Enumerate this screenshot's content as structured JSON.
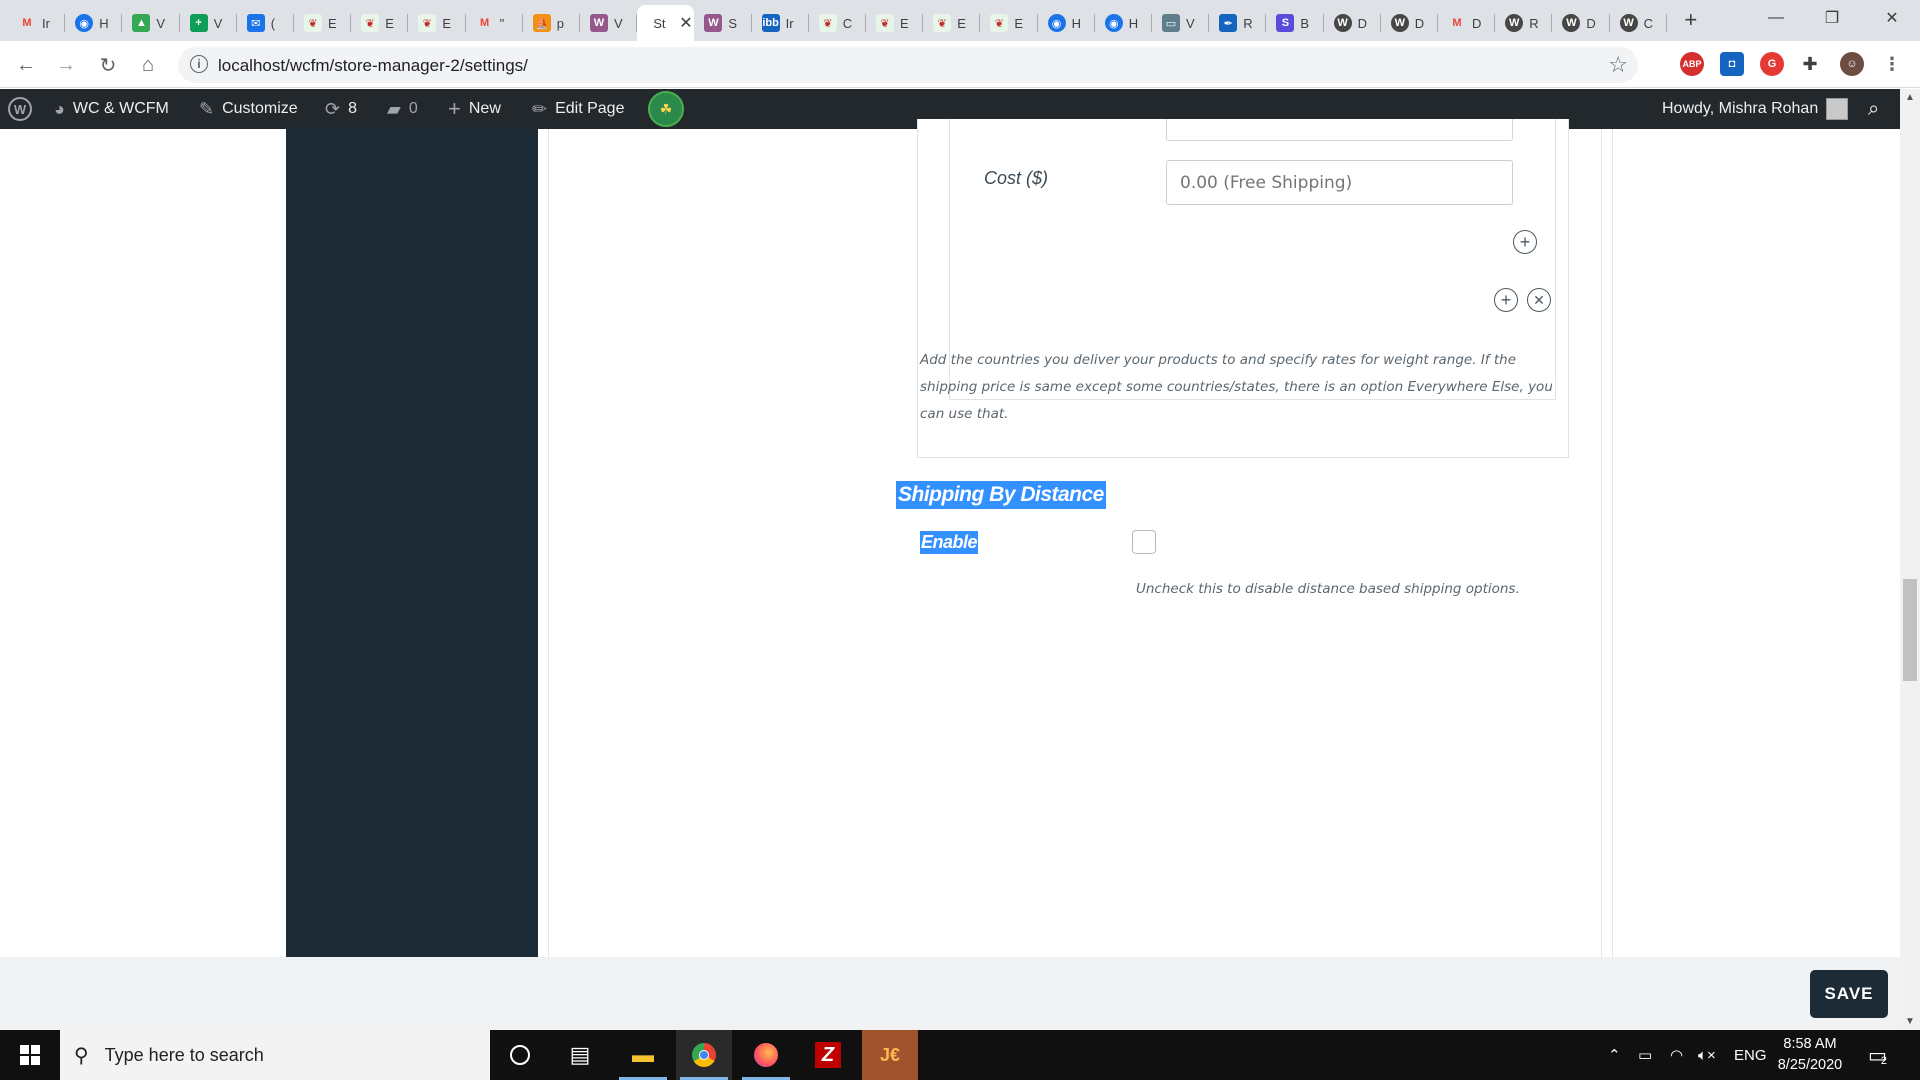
{
  "browser": {
    "tabs": [
      {
        "icon": "gmail-icon",
        "label": "Ir",
        "color": "#ea4335",
        "glyph": "M"
      },
      {
        "icon": "globe-icon",
        "label": "H",
        "color": "#1a73e8",
        "glyph": "◉"
      },
      {
        "icon": "google-drive-icon",
        "label": "V",
        "color": "#34a853",
        "glyph": "▲"
      },
      {
        "icon": "sheets-icon",
        "label": "V",
        "color": "#0f9d58",
        "glyph": "+"
      },
      {
        "icon": "mail-icon",
        "label": "(",
        "color": "#1a73e8",
        "glyph": "✉"
      },
      {
        "icon": "leaf-icon",
        "label": "E",
        "color": "#e8f5e9",
        "glyph": "❦"
      },
      {
        "icon": "leaf-icon",
        "label": "E",
        "color": "#e8f5e9",
        "glyph": "❦"
      },
      {
        "icon": "leaf-icon",
        "label": "E",
        "color": "#e8f5e9",
        "glyph": "❦"
      },
      {
        "icon": "gmail-icon",
        "label": "\"",
        "color": "#ea4335",
        "glyph": "M"
      },
      {
        "icon": "phpmyadmin-icon",
        "label": "p",
        "color": "#f29111",
        "glyph": "⛵"
      },
      {
        "icon": "woo-icon",
        "label": "V",
        "color": "#96588a",
        "glyph": "W"
      },
      {
        "icon": "store-tab-icon",
        "label": "St",
        "color": "#ffffff",
        "glyph": ""
      },
      {
        "icon": "woo-icon",
        "label": "S",
        "color": "#96588a",
        "glyph": "W"
      },
      {
        "icon": "ibb-icon",
        "label": "Ir",
        "color": "#1565c0",
        "glyph": "ibb"
      },
      {
        "icon": "leaf-icon",
        "label": "C",
        "color": "#e8f5e9",
        "glyph": "❦"
      },
      {
        "icon": "leaf-icon",
        "label": "E",
        "color": "#e8f5e9",
        "glyph": "❦"
      },
      {
        "icon": "leaf-icon",
        "label": "E",
        "color": "#e8f5e9",
        "glyph": "❦"
      },
      {
        "icon": "leaf-icon",
        "label": "E",
        "color": "#e8f5e9",
        "glyph": "❦"
      },
      {
        "icon": "globe-icon",
        "label": "H",
        "color": "#1a73e8",
        "glyph": "◉"
      },
      {
        "icon": "globe-icon",
        "label": "H",
        "color": "#1a73e8",
        "glyph": "◉"
      },
      {
        "icon": "monitor-icon",
        "label": "V",
        "color": "#607d8b",
        "glyph": "▭"
      },
      {
        "icon": "feather-icon",
        "label": "R",
        "color": "#1565c0",
        "glyph": "✒"
      },
      {
        "icon": "s-icon",
        "label": "B",
        "color": "#5b4bdb",
        "glyph": "S"
      },
      {
        "icon": "wordpress-icon",
        "label": "D",
        "color": "#464646",
        "glyph": "W"
      },
      {
        "icon": "wordpress-icon",
        "label": "D",
        "color": "#464646",
        "glyph": "W"
      },
      {
        "icon": "gmail-icon",
        "label": "D",
        "color": "#ea4335",
        "glyph": "M"
      },
      {
        "icon": "wordpress-icon",
        "label": "R",
        "color": "#464646",
        "glyph": "W"
      },
      {
        "icon": "wordpress-icon",
        "label": "D",
        "color": "#464646",
        "glyph": "W"
      },
      {
        "icon": "wordpress-icon",
        "label": "C",
        "color": "#464646",
        "glyph": "W"
      }
    ],
    "active_tab_label": "St",
    "url": "localhost/wcfm/store-manager-2/settings/"
  },
  "adminbar": {
    "site_name": "WC & WCFM",
    "customize": "Customize",
    "updates_count": "8",
    "comments_count": "0",
    "new_label": "New",
    "edit_page": "Edit Page",
    "greeting": "Howdy, Mishra Rohan"
  },
  "shipping": {
    "cost_label": "Cost ($)",
    "cost_placeholder": "0.00 (Free Shipping)",
    "description": "Add the countries you deliver your products to and specify rates for weight range. If the shipping price is same except some countries/states, there is an option Everywhere Else, you can use that.",
    "distance_title": "Shipping By Distance",
    "enable_label": "Enable",
    "enable_checked": false,
    "enable_hint": "Uncheck this to disable distance based shipping options."
  },
  "footer": {
    "save_label": "SAVE"
  },
  "taskbar": {
    "search_placeholder": "Type here to search",
    "language": "ENG",
    "time": "8:58 AM",
    "date": "8/25/2020",
    "notification_count": "2"
  },
  "colors": {
    "selection": "#3390ff",
    "sidebar": "#1c2b36",
    "adminbar": "#23282d"
  }
}
